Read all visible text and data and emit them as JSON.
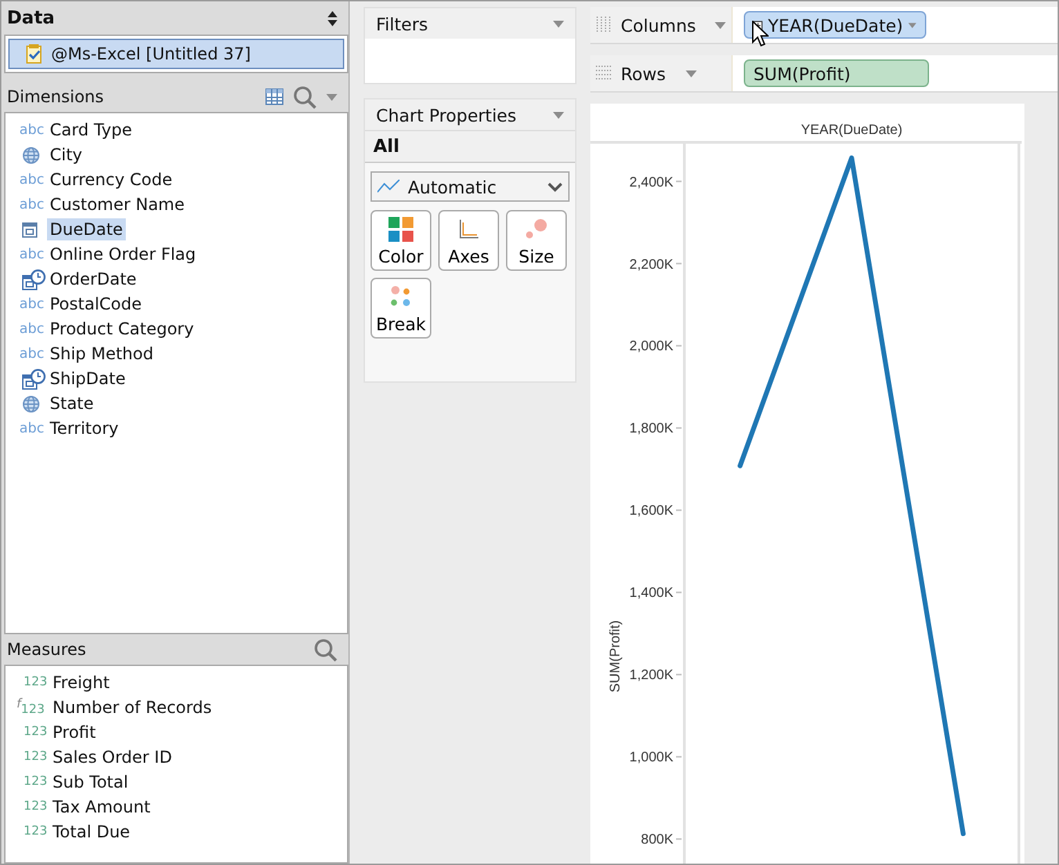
{
  "data_panel": {
    "title": "Data",
    "sources": [
      {
        "name": "@Ms-Excel [Untitled 37]",
        "selected": true
      }
    ]
  },
  "dimensions": {
    "title": "Dimensions",
    "items": [
      {
        "kind": "string",
        "type_mark": "abc",
        "name": "Card Type",
        "selected": false
      },
      {
        "kind": "geo",
        "name": "City",
        "selected": false
      },
      {
        "kind": "string",
        "type_mark": "abc",
        "name": "Currency Code",
        "selected": false
      },
      {
        "kind": "string",
        "type_mark": "abc",
        "name": "Customer Name",
        "selected": false
      },
      {
        "kind": "date",
        "name": "DueDate",
        "selected": true
      },
      {
        "kind": "string",
        "type_mark": "abc",
        "name": "Online Order Flag",
        "selected": false
      },
      {
        "kind": "datetime",
        "name": "OrderDate",
        "selected": false
      },
      {
        "kind": "string",
        "type_mark": "abc",
        "name": "PostalCode",
        "selected": false
      },
      {
        "kind": "string",
        "type_mark": "abc",
        "name": "Product Category",
        "selected": false
      },
      {
        "kind": "string",
        "type_mark": "abc",
        "name": "Ship Method",
        "selected": false
      },
      {
        "kind": "datetime",
        "name": "ShipDate",
        "selected": false
      },
      {
        "kind": "geo",
        "name": "State",
        "selected": false
      },
      {
        "kind": "string",
        "type_mark": "abc",
        "name": "Territory",
        "selected": false
      }
    ]
  },
  "measures": {
    "title": "Measures",
    "items": [
      {
        "kind": "number",
        "type_mark": "123",
        "name": "Freight",
        "selected": false
      },
      {
        "kind": "calculated",
        "formula_mark": "f",
        "type_mark": "123",
        "name": "Number of Records",
        "selected": false
      },
      {
        "kind": "number",
        "type_mark": "123",
        "name": "Profit",
        "selected": false
      },
      {
        "kind": "number",
        "type_mark": "123",
        "name": "Sales Order ID",
        "selected": false
      },
      {
        "kind": "number",
        "type_mark": "123",
        "name": "Sub Total",
        "selected": false
      },
      {
        "kind": "number",
        "type_mark": "123",
        "name": "Tax Amount",
        "selected": false
      },
      {
        "kind": "number",
        "type_mark": "123",
        "name": "Total Due",
        "selected": false
      }
    ]
  },
  "filters": {
    "title": "Filters"
  },
  "chart_properties": {
    "title": "Chart Properties",
    "scope": "All",
    "mark_type": "Automatic",
    "buttons": [
      {
        "kind": "color",
        "label": "Color"
      },
      {
        "kind": "axes",
        "label": "Axes"
      },
      {
        "kind": "size",
        "label": "Size"
      },
      {
        "kind": "break",
        "label": "Break"
      }
    ]
  },
  "columns_shelf": {
    "label": "Columns",
    "pills": [
      {
        "kind": "dimension",
        "label": "YEAR(DueDate)"
      }
    ]
  },
  "rows_shelf": {
    "label": "Rows",
    "pills": [
      {
        "kind": "measure",
        "label": "SUM(Profit)"
      }
    ]
  },
  "chart": {
    "chart_data": {
      "type": "line",
      "title": "YEAR(DueDate)",
      "ylabel": "SUM(Profit)",
      "ylim": [
        720,
        2495
      ],
      "series": [
        {
          "color": "#1f77b4",
          "values": [
            1708,
            2457,
            813
          ]
        }
      ],
      "yticks": [
        {
          "value": 800,
          "label": "800K"
        },
        {
          "value": 1000,
          "label": "1,000K"
        },
        {
          "value": 1200,
          "label": "1,200K"
        },
        {
          "value": 1400,
          "label": "1,400K"
        },
        {
          "value": 1600,
          "label": "1,600K"
        },
        {
          "value": 1800,
          "label": "1,800K"
        },
        {
          "value": 2000,
          "label": "2,000K"
        },
        {
          "value": 2200,
          "label": "2,200K"
        },
        {
          "value": 2400,
          "label": "2,400K"
        }
      ]
    }
  }
}
